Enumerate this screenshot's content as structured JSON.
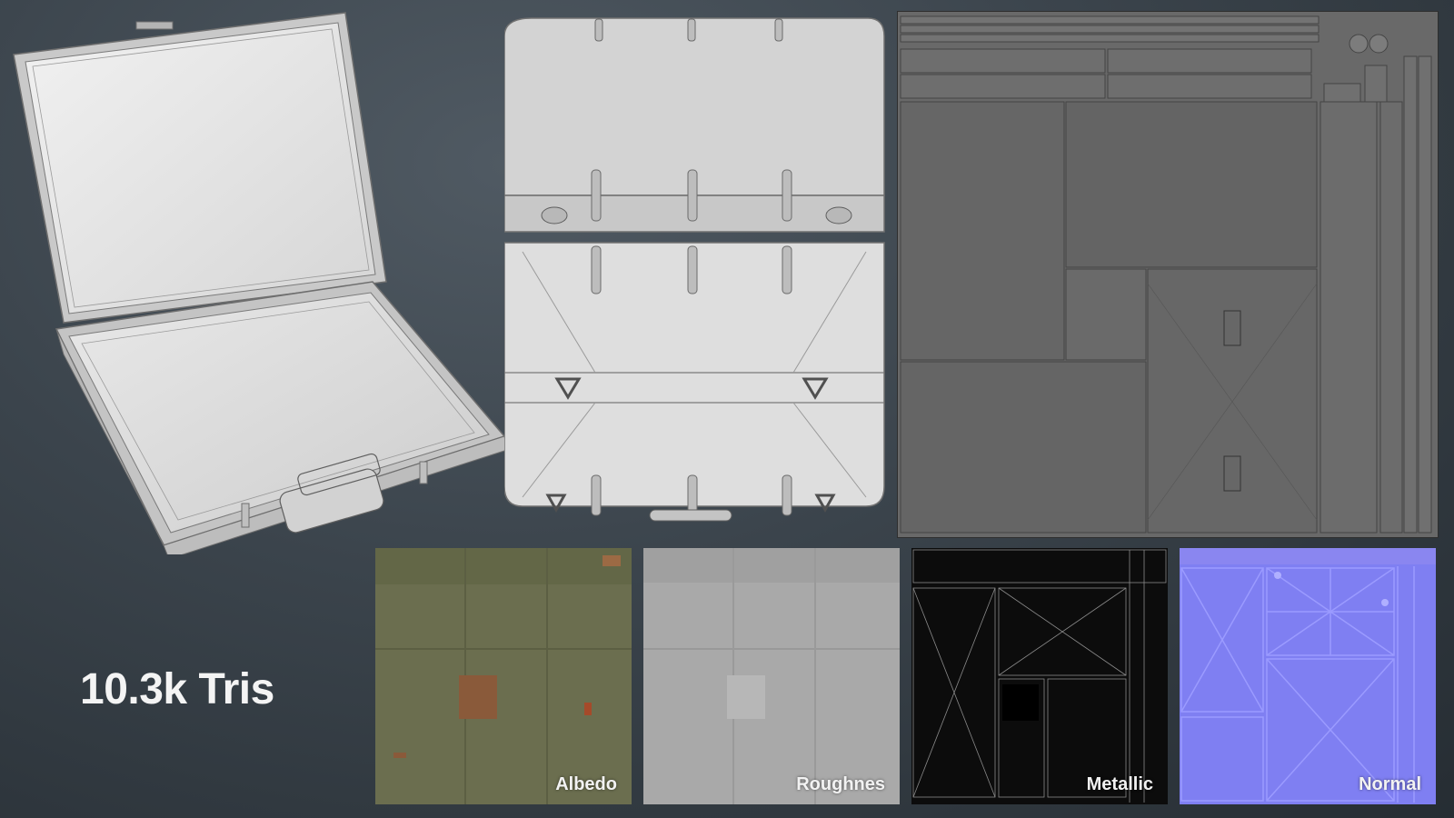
{
  "stats": {
    "tris_label": "10.3k Tris"
  },
  "textures": [
    {
      "label": "Albedo",
      "base_color": "#6b6e4f"
    },
    {
      "label": "Roughnes",
      "base_color": "#a9a9a9"
    },
    {
      "label": "Metallic",
      "base_color": "#0c0c0c"
    },
    {
      "label": "Normal",
      "base_color": "#7f7ff2"
    }
  ],
  "colors": {
    "background": "#3b444c",
    "model_surface": "#cfcfcf",
    "wireframe": "#6e6e6e",
    "uv_background": "#6a6a6a",
    "uv_lines": "#4a4a4a"
  }
}
